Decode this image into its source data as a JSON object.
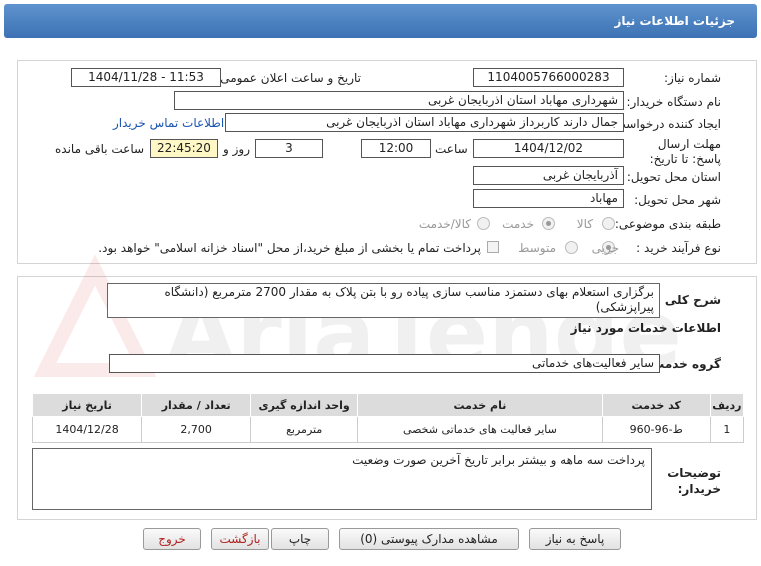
{
  "header": {
    "title": "جزئیات اطلاعات نیاز"
  },
  "need_info": {
    "need_number_label": "شماره نیاز:",
    "need_number": "1104005766000283",
    "announce_label": "تاریخ و ساعت اعلان عمومی:",
    "announce_value": "1404/11/28 - 11:53",
    "buyer_org_label": "نام دستگاه خریدار:",
    "buyer_org": "شهرداری مهاباد استان اذربایجان غربی",
    "requester_label": "ایجاد کننده درخواست:",
    "requester": "جمال دارند کاربرداز  شهرداری مهاباد استان اذربایجان غربی",
    "contact_link": "اطلاعات تماس خریدار",
    "deadline_label": "مهلت ارسال پاسخ: تا تاریخ:",
    "deadline_date": "1404/12/02",
    "time_label": "ساعت",
    "deadline_time": "12:00",
    "days_value": "3",
    "days_label": "روز و",
    "remaining_time": "22:45:20",
    "remaining_label": "ساعت باقی مانده",
    "province_label": "استان محل تحویل:",
    "province": "آذربایجان غربی",
    "city_label": "شهر محل تحویل:",
    "city": "مهاباد",
    "category_label": "طبقه بندی موضوعی:",
    "category_options": [
      "کالا",
      "خدمت",
      "کالا/خدمت"
    ],
    "category_selected": "خدمت",
    "process_label": "نوع فرآیند خرید :",
    "process_options": [
      "جزیی",
      "متوسط"
    ],
    "process_selected": "جزیی",
    "payment_note": "پرداخت تمام یا بخشی از مبلغ خرید،از محل \"اسناد خزانه اسلامی\" خواهد بود."
  },
  "services": {
    "summary_label": "شرح کلی نیاز:",
    "summary": "برگزاری استعلام بهای دستمزد مناسب سازی پیاده رو با بتن پلاک به مقدار 2700 مترمربع (دانشگاه پیراپزشکی)",
    "section_title": "اطلاعات خدمات مورد نیاز",
    "group_label": "گروه خدمت:",
    "group_value": "سایر فعالیت‌های خدماتی",
    "table": {
      "headers": [
        "ردیف",
        "کد خدمت",
        "نام خدمت",
        "واحد اندازه گیری",
        "تعداد / مقدار",
        "تاریخ نیاز"
      ],
      "rows": [
        [
          "1",
          "ط-96-960",
          "سایر فعالیت های خدماتی شخصی",
          "مترمربع",
          "2,700",
          "1404/12/28"
        ]
      ]
    },
    "buyer_notes_label": "توضیحات خریدار:",
    "buyer_notes": "پرداخت سه ماهه و بیشتر برابر تاریخ آخرین صورت وضعیت"
  },
  "buttons": {
    "reply": "پاسخ به نیاز",
    "attachments": "مشاهده مدارک پیوستی (0)",
    "print": "چاپ",
    "back": "بازگشت",
    "exit": "خروج"
  },
  "watermark_text": "AriaTender.net"
}
